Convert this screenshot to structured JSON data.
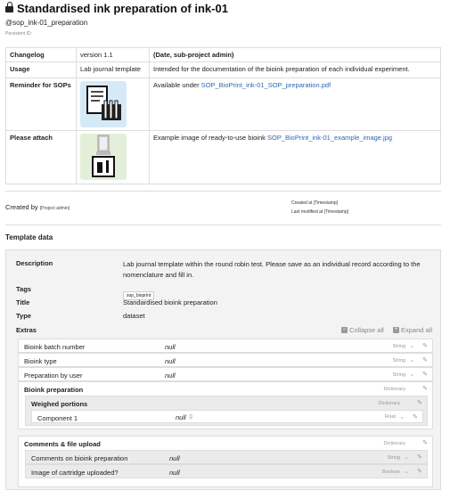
{
  "header": {
    "title": "Standardised ink preparation of ink-01",
    "handle": "@sop_ink-01_preparation",
    "persistent_id": "Persistent ID:"
  },
  "changelog": {
    "rows": [
      {
        "c1": "Changelog",
        "c2": "version 1.1",
        "c3": "(Date, sub-project admin)"
      },
      {
        "c1": "Usage",
        "c2": "Lab journal template",
        "c3": "Intended for the documentation of the bioink preparation of each individual experiment."
      },
      {
        "c1": "Reminder for SOPs",
        "c3_prefix": "Available under ",
        "c3_link": "SOP_BioPrint_ink-01_SOP_preparation.pdf"
      },
      {
        "c1": "Please attach",
        "c3_prefix": "Example image of ready-to-use bioink ",
        "c3_link": "SOP_BioPrint_ink-01_example_image.jpg"
      }
    ]
  },
  "meta": {
    "created_by_label": "Created by",
    "created_by_value": "[Project admin]",
    "created_at": "Created at [Timestamp]",
    "last_modified": "Last modified at [Timestamp]"
  },
  "template": {
    "section_label": "Template data",
    "description_label": "Description",
    "description": "Lab journal template within the round robin test. Please save as an individual record according to the nomenclature and fill in.",
    "tags_label": "Tags",
    "tag": "sop_bioprint",
    "title_label": "Title",
    "title": "Standardised bioink preparation",
    "type_label": "Type",
    "type": "dataset",
    "extras_label": "Extras",
    "collapse_all": "Collapse all",
    "expand_all": "Expand all",
    "extras": [
      {
        "name": "Bioink batch number",
        "value": "null",
        "type": "String"
      },
      {
        "name": "Bioink type",
        "value": "null",
        "type": "String"
      },
      {
        "name": "Preparation by user",
        "value": "null",
        "type": "String"
      },
      {
        "name": "Bioink preparation",
        "type": "Dictionary"
      },
      {
        "name": "Weighed portions",
        "type": "Dictionary"
      },
      {
        "name": "Component 1",
        "value": "null",
        "unit": "g",
        "type": "Float"
      },
      {
        "name": "Comments & file upload",
        "type": "Dictionary"
      },
      {
        "name": "Comments on bioink preparation",
        "value": "null",
        "type": "String"
      },
      {
        "name": "Image of cartridge uploaded?",
        "value": "null",
        "type": "Boolean"
      }
    ]
  }
}
